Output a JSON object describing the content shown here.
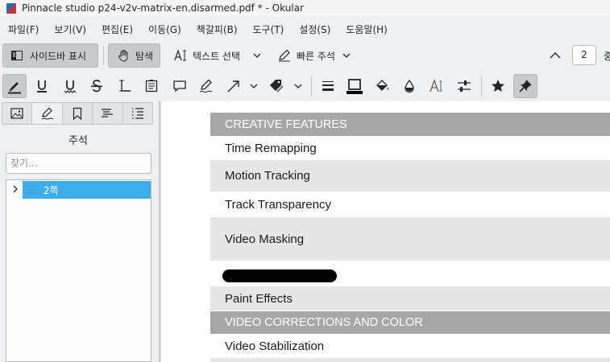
{
  "window": {
    "title": "Pinnacle studio p24-v2v-matrix-en.disarmed.pdf * - Okular"
  },
  "menu": [
    "파일(F)",
    "보기(V)",
    "편집(E)",
    "이동(G)",
    "책갈피(B)",
    "도구(T)",
    "설정(S)",
    "도움말(H)"
  ],
  "toolbar": {
    "sidebar_label": "사이드바 표시",
    "browse_label": "탐색",
    "text_select_label": "텍스트 선택",
    "quick_note_label": "빠른 주석",
    "page_number": "2",
    "page_suffix": "중"
  },
  "sidebar": {
    "title": "주석",
    "search_placeholder": "찾기...",
    "tree_item": "2쪽"
  },
  "document": {
    "header1": "CREATIVE FEATURES",
    "rows1": [
      "Time Remapping",
      "Motion Tracking",
      "Track Transparency",
      "Video Masking"
    ],
    "row_paint": "Paint Effects",
    "header2": "VIDEO CORRECTIONS AND COLOR",
    "row_stab": "Video Stabilization"
  },
  "colors": {
    "selection": "#3daee9",
    "header_band": "#a7a7a7",
    "shade_band": "#e6e6e6"
  }
}
